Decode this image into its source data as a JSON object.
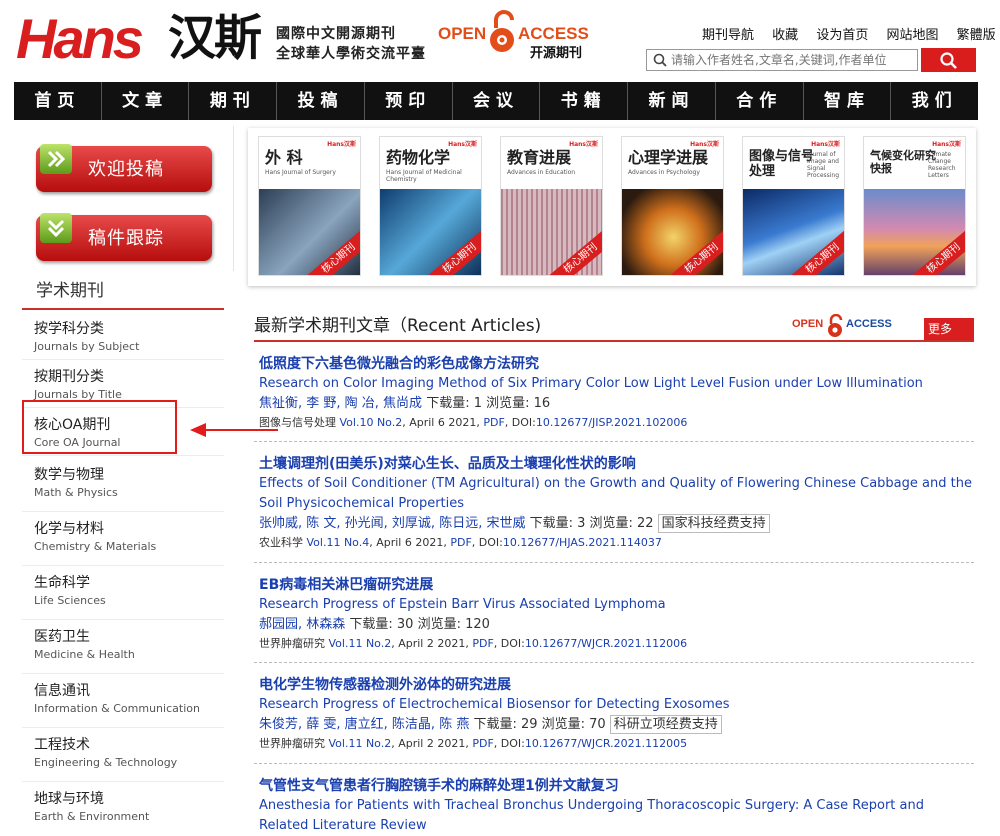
{
  "header": {
    "logo_en": "Hans",
    "logo_cn": "汉斯",
    "tagline_1": "國際中文開源期刊",
    "tagline_2": "全球華人學術交流平臺",
    "oa_open": "OPEN",
    "oa_access": "ACCESS",
    "oa_sub": "开源期刊",
    "top_links": [
      "期刊导航",
      "收藏",
      "设为首页",
      "网站地图",
      "繁體版"
    ],
    "search_placeholder": "请输入作者姓名,文章名,关键词,作者单位"
  },
  "nav": [
    "首页",
    "文章",
    "期刊",
    "投稿",
    "预印",
    "会议",
    "书籍",
    "新闻",
    "合作",
    "智库",
    "我们"
  ],
  "sidebar": {
    "submit_button": "欢迎投稿",
    "track_button": "稿件跟踪",
    "heading": "学术期刊",
    "categories": [
      {
        "cn": "按学科分类",
        "en": "Journals by Subject"
      },
      {
        "cn": "按期刊分类",
        "en": "Journals by Title"
      },
      {
        "cn": "核心OA期刊",
        "en": "Core OA Journal"
      },
      {
        "cn": "数学与物理",
        "en": "Math & Physics"
      },
      {
        "cn": "化学与材料",
        "en": "Chemistry & Materials"
      },
      {
        "cn": "生命科学",
        "en": "Life Sciences"
      },
      {
        "cn": "医药卫生",
        "en": "Medicine & Health"
      },
      {
        "cn": "信息通讯",
        "en": "Information & Communication"
      },
      {
        "cn": "工程技术",
        "en": "Engineering & Technology"
      },
      {
        "cn": "地球与环境",
        "en": "Earth & Environment"
      }
    ]
  },
  "covers": [
    {
      "title": "外 科",
      "sub": "Hans Journal of Surgery",
      "badge": "核心期刊",
      "pub": "Hans汉斯"
    },
    {
      "title": "药物化学",
      "sub": "Hans Journal of Medicinal Chemistry",
      "badge": "核心期刊",
      "pub": "Hans汉斯"
    },
    {
      "title": "教育进展",
      "sub": "Advances in Education",
      "badge": "核心期刊",
      "pub": "Hans汉斯"
    },
    {
      "title": "心理学进展",
      "sub": "Advances in Psychology",
      "badge": "核心期刊",
      "pub": "Hans汉斯"
    },
    {
      "title": "图像与信号处理",
      "sub": "Journal of Image and Signal Processing",
      "badge": "核心期刊",
      "pub": "Hans汉斯"
    },
    {
      "title": "气候变化研究快报",
      "sub": "Climate Change Research Letters",
      "badge": "核心期刊",
      "pub": "Hans汉斯"
    }
  ],
  "recent": {
    "title": "最新学术期刊文章（Recent Articles)",
    "oa_open": "OPEN",
    "oa_access": "ACCESS",
    "more": "更多 >>"
  },
  "articles": [
    {
      "title_cn": "低照度下六基色微光融合的彩色成像方法研究",
      "title_en": "Research on Color Imaging Method of Six Primary Color Low Light Level Fusion under Low Illumination",
      "authors": "焦祉衡, 李 野, 陶 冶, 焦尚成",
      "stats": " 下载量: 1  浏览量: 16",
      "fund": "",
      "journal": "图像与信号处理",
      "volume": "Vol.10 No.2",
      "date": ", April 6 2021, ",
      "pdf": "PDF",
      "doi_label": ", DOI:",
      "doi": "10.12677/JISP.2021.102006"
    },
    {
      "title_cn": "土壤调理剂(田美乐)对菜心生长、品质及土壤理化性状的影响",
      "title_en": "Effects of Soil Conditioner (TM Agricultural) on the Growth and Quality of Flowering Chinese Cabbage and the Soil Physicochemical Properties",
      "authors": "张帅威, 陈 文, 孙光闻, 刘厚诚, 陈日远, 宋世威",
      "stats": " 下载量: 3  浏览量: 22",
      "fund": "国家科技经费支持",
      "journal": "农业科学",
      "volume": "Vol.11 No.4",
      "date": ", April 6 2021, ",
      "pdf": "PDF",
      "doi_label": ", DOI:",
      "doi": "10.12677/HJAS.2021.114037"
    },
    {
      "title_cn": "EB病毒相关淋巴瘤研究进展",
      "title_en": "Research Progress of Epstein Barr Virus Associated Lymphoma",
      "authors": "郝园园, 林森森",
      "stats": " 下载量: 30  浏览量: 120",
      "fund": "",
      "journal": "世界肿瘤研究",
      "volume": "Vol.11 No.2",
      "date": ", April 2 2021, ",
      "pdf": "PDF",
      "doi_label": ", DOI:",
      "doi": "10.12677/WJCR.2021.112006"
    },
    {
      "title_cn": "电化学生物传感器检测外泌体的研究进展",
      "title_en": "Research Progress of Electrochemical Biosensor for Detecting Exosomes",
      "authors": "朱俊芳, 薛 雯, 唐立红, 陈洁晶, 陈 燕",
      "stats": " 下载量: 29  浏览量: 70",
      "fund": "科研立项经费支持",
      "journal": "世界肿瘤研究",
      "volume": "Vol.11 No.2",
      "date": ", April 2 2021, ",
      "pdf": "PDF",
      "doi_label": ", DOI:",
      "doi": "10.12677/WJCR.2021.112005"
    },
    {
      "title_cn": "气管性支气管患者行胸腔镜手术的麻醉处理1例并文献复习",
      "title_en": "Anesthesia for Patients with Tracheal Bronchus Undergoing Thoracoscopic Surgery: A Case Report and Related Literature Review"
    }
  ],
  "colors": {
    "brand_red": "#d81e1e",
    "link_blue": "#1a3fae",
    "nav_bg": "#111111"
  }
}
